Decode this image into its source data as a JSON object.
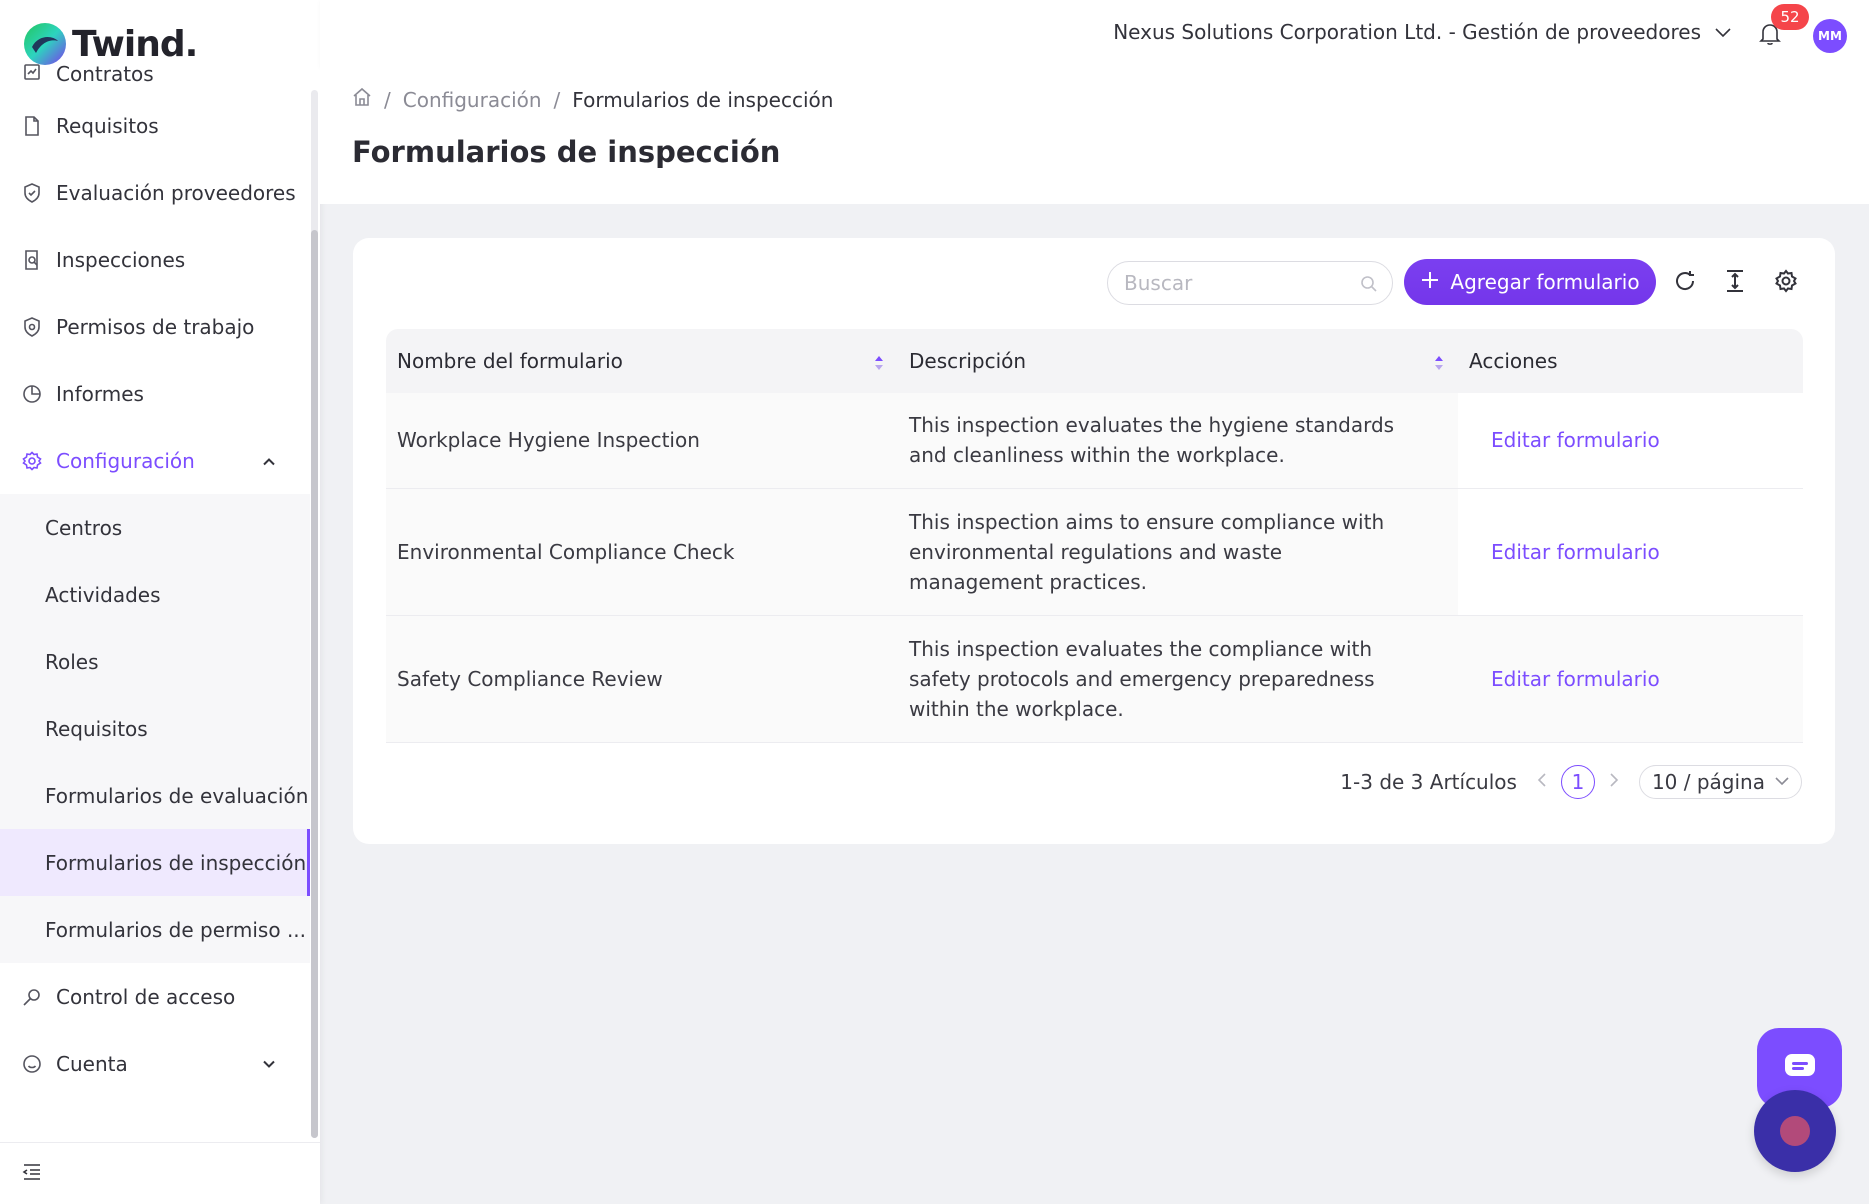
{
  "app": {
    "logo_text": "Twind."
  },
  "header": {
    "organization": "Nexus Solutions Corporation Ltd. - Gestión de proveedores",
    "notification_count": "52",
    "avatar_initials": "MM"
  },
  "sidebar": {
    "items": [
      {
        "label": "Contratos",
        "icon": "contract-icon"
      },
      {
        "label": "Requisitos",
        "icon": "document-icon"
      },
      {
        "label": "Evaluación proveedores",
        "icon": "shield-check-icon"
      },
      {
        "label": "Inspecciones",
        "icon": "inspection-icon"
      },
      {
        "label": "Permisos de trabajo",
        "icon": "shield-icon"
      },
      {
        "label": "Informes",
        "icon": "pie-chart-icon"
      }
    ],
    "config": {
      "label": "Configuración",
      "icon": "gear-icon",
      "children": [
        "Centros",
        "Actividades",
        "Roles",
        "Requisitos",
        "Formularios de evaluación",
        "Formularios de inspección",
        "Formularios de permiso ..."
      ]
    },
    "access_control": {
      "label": "Control de acceso",
      "icon": "key-icon"
    },
    "account": {
      "label": "Cuenta",
      "icon": "smile-icon"
    }
  },
  "breadcrumb": {
    "parent": "Configuración",
    "current": "Formularios de inspección",
    "separator": "/"
  },
  "page": {
    "title": "Formularios de inspección"
  },
  "toolbar": {
    "search_placeholder": "Buscar",
    "add_label": "Agregar formulario"
  },
  "table": {
    "columns": [
      "Nombre del formulario",
      "Descripción",
      "Acciones"
    ],
    "rows": [
      {
        "name": "Workplace Hygiene Inspection",
        "description": "This inspection evaluates the hygiene standards and cleanliness within the workplace.",
        "action": "Editar formulario"
      },
      {
        "name": "Environmental Compliance Check",
        "description": "This inspection aims to ensure compliance with environmental regulations and waste management practices.",
        "action": "Editar formulario"
      },
      {
        "name": "Safety Compliance Review",
        "description": "This inspection evaluates the compliance with safety protocols and emergency preparedness within the workplace.",
        "action": "Editar formulario"
      }
    ]
  },
  "pagination": {
    "summary": "1-3 de 3 Artículos",
    "current_page": "1",
    "page_size": "10 / página"
  },
  "colors": {
    "accent": "#7c4dff",
    "badge": "#f5454a",
    "button": "#7436ea"
  }
}
